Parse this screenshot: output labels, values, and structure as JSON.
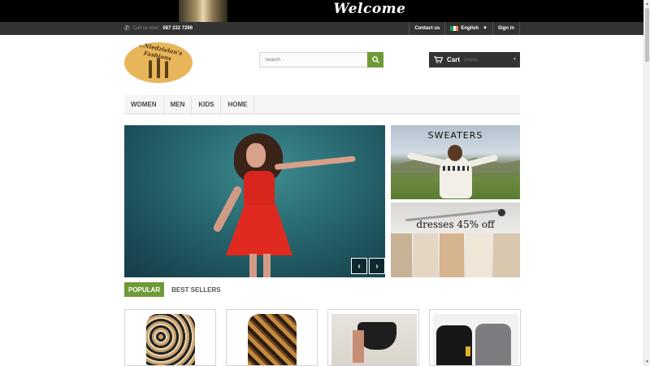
{
  "banner": {
    "title": "Welcome"
  },
  "topbar": {
    "call_label": "Call us now:",
    "phone": "087 232 7296",
    "contact": "Contact us",
    "language": "English",
    "signin": "Sign in"
  },
  "header": {
    "logo_text": "M.Niedzielan's Fashions",
    "search_placeholder": "Search",
    "cart_label": "Cart",
    "cart_status": "(empty)"
  },
  "menu": [
    "WOMEN",
    "MEN",
    "KIDS",
    "HOME"
  ],
  "side_banners": {
    "sweaters": "SWEATERS",
    "dresses": "dresses 45% off"
  },
  "tabs": [
    "POPULAR",
    "BEST SELLERS"
  ],
  "colors": {
    "accent": "#6f9a37",
    "dark": "#333333"
  },
  "icons": {
    "phone": "phone-icon",
    "search": "search-icon",
    "cart": "cart-icon",
    "prev": "chevron-left-icon",
    "next": "chevron-right-icon"
  }
}
